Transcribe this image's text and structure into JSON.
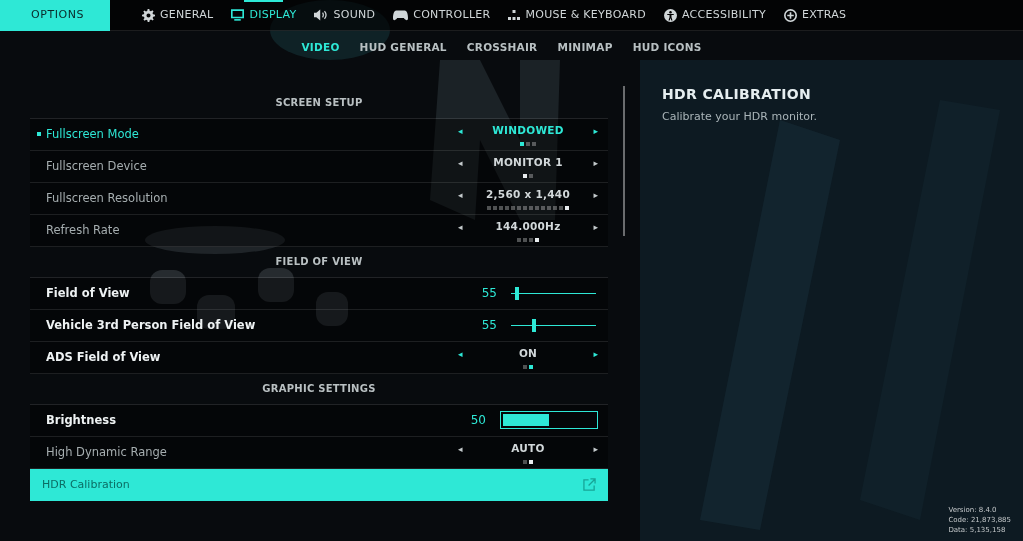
{
  "header": {
    "title": "OPTIONS"
  },
  "tabs": [
    {
      "label": "GENERAL",
      "selected": false
    },
    {
      "label": "DISPLAY",
      "selected": true
    },
    {
      "label": "SOUND",
      "selected": false
    },
    {
      "label": "CONTROLLER",
      "selected": false
    },
    {
      "label": "MOUSE & KEYBOARD",
      "selected": false
    },
    {
      "label": "ACCESSIBILITY",
      "selected": false
    },
    {
      "label": "EXTRAS",
      "selected": false
    }
  ],
  "subtabs": [
    {
      "label": "VIDEO",
      "selected": true
    },
    {
      "label": "HUD GENERAL",
      "selected": false
    },
    {
      "label": "CROSSHAIR",
      "selected": false
    },
    {
      "label": "MINIMAP",
      "selected": false
    },
    {
      "label": "HUD ICONS",
      "selected": false
    }
  ],
  "settings": [
    {
      "kind": "header",
      "label": "SCREEN SETUP"
    },
    {
      "kind": "selector",
      "label": "Fullscreen Mode",
      "focused": true,
      "disabled": false,
      "prev": "◂",
      "value": "WINDOWED",
      "next": "▸",
      "dots": [
        {
          "selected": true
        },
        {
          "selected": false
        },
        {
          "selected": false
        }
      ]
    },
    {
      "kind": "selector",
      "label": "Fullscreen Device",
      "focused": false,
      "disabled": true,
      "prev": "◂",
      "value": "MONITOR 1",
      "next": "▸",
      "dots": [
        {
          "selected": true
        },
        {
          "selected": false
        }
      ]
    },
    {
      "kind": "selector",
      "label": "Fullscreen Resolution",
      "focused": false,
      "disabled": true,
      "prev": "◂",
      "value": "2,560 x 1,440",
      "next": "▸",
      "dots": [
        {
          "selected": false
        },
        {
          "selected": false
        },
        {
          "selected": false
        },
        {
          "selected": false
        },
        {
          "selected": false
        },
        {
          "selected": false
        },
        {
          "selected": false
        },
        {
          "selected": false
        },
        {
          "selected": false
        },
        {
          "selected": false
        },
        {
          "selected": false
        },
        {
          "selected": false
        },
        {
          "selected": false
        },
        {
          "selected": true
        }
      ]
    },
    {
      "kind": "selector",
      "label": "Refresh Rate",
      "focused": false,
      "disabled": true,
      "prev": "◂",
      "value": "144.000Hz",
      "next": "▸",
      "dots": [
        {
          "selected": false
        },
        {
          "selected": false
        },
        {
          "selected": false
        },
        {
          "selected": true
        }
      ]
    },
    {
      "kind": "header",
      "label": "FIELD OF VIEW"
    },
    {
      "kind": "slider",
      "label": "Field of View",
      "focused": false,
      "disabled": false,
      "reading": "55",
      "level": 0.07
    },
    {
      "kind": "slider",
      "label": "Vehicle 3rd Person Field of View",
      "focused": false,
      "disabled": false,
      "reading": "55",
      "level": 0.27
    },
    {
      "kind": "selector",
      "label": "ADS Field of View",
      "focused": false,
      "disabled": false,
      "prev": "◂",
      "value": "ON",
      "next": "▸",
      "dots": [
        {
          "selected": false
        },
        {
          "selected": true
        }
      ]
    },
    {
      "kind": "header",
      "label": "GRAPHIC SETTINGS"
    },
    {
      "kind": "bar",
      "label": "Brightness",
      "focused": false,
      "disabled": false,
      "reading": "50",
      "level": 0.5
    },
    {
      "kind": "selector",
      "label": "High Dynamic Range",
      "focused": false,
      "disabled": true,
      "prev": "◂",
      "value": "AUTO",
      "next": "▸",
      "dots": [
        {
          "selected": false
        },
        {
          "selected": true
        }
      ]
    },
    {
      "kind": "link",
      "label": "HDR Calibration",
      "selected": true
    }
  ],
  "detail": {
    "title": "HDR CALIBRATION",
    "description": "Calibrate your HDR monitor."
  },
  "build_info": [
    "Version: 8.4.0",
    "Code: 21,873,885",
    "Data: 5,135,158"
  ]
}
